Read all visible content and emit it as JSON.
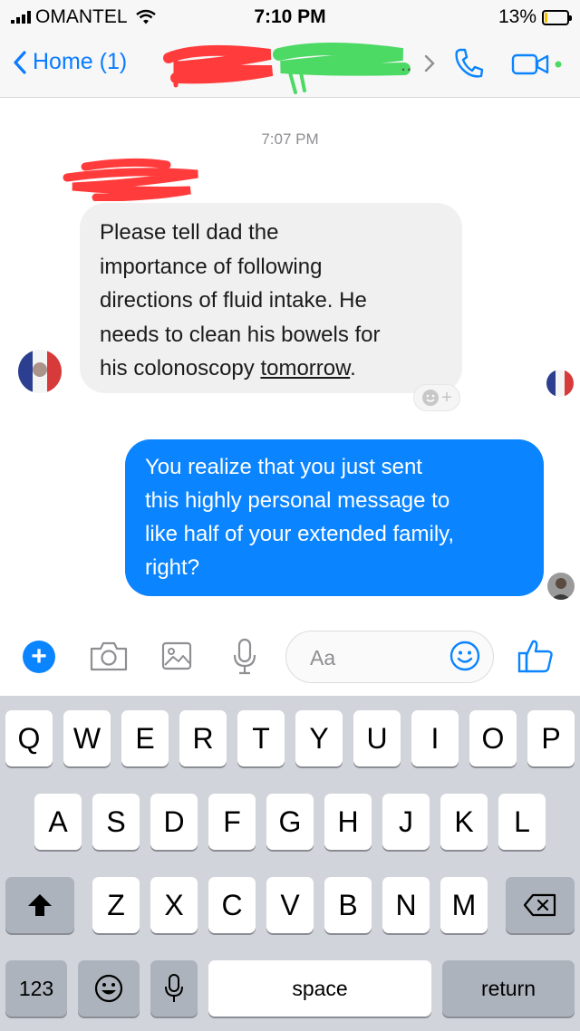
{
  "status_bar": {
    "carrier": "OMANTEL",
    "time": "7:10 PM",
    "battery": "13%",
    "battery_level": 0.13
  },
  "nav": {
    "back_label": "Home (1)",
    "ellipsis": "..",
    "icons": [
      "chevron-left-icon",
      "chevron-right-icon",
      "phone-icon",
      "video-icon"
    ]
  },
  "conversation": {
    "timestamp": "7:07 PM",
    "incoming": {
      "lines": [
        "Please tell dad the",
        "importance of following",
        "directions of fluid intake. He",
        "needs to clean his bowels for"
      ],
      "last_line_prefix": "his colonoscopy ",
      "last_line_link": "tomorrow",
      "last_line_suffix": "."
    },
    "outgoing": {
      "lines": [
        "You realize that you just sent",
        "this highly personal message to",
        "like half of your extended family,",
        "right?"
      ]
    },
    "react_plus": "+"
  },
  "composer": {
    "plus": "+",
    "placeholder": "Aa"
  },
  "keyboard": {
    "row1": [
      "Q",
      "W",
      "E",
      "R",
      "T",
      "Y",
      "U",
      "I",
      "O",
      "P"
    ],
    "row2": [
      "A",
      "S",
      "D",
      "F",
      "G",
      "H",
      "J",
      "K",
      "L"
    ],
    "row3": [
      "Z",
      "X",
      "C",
      "V",
      "B",
      "N",
      "M"
    ],
    "numbers": "123",
    "space": "space",
    "return": "return"
  },
  "colors": {
    "accent": "#0a84ff",
    "bubble_in": "#f0f0f0",
    "redaction_red": "#ff3b3b",
    "redaction_green": "#4cd964"
  }
}
